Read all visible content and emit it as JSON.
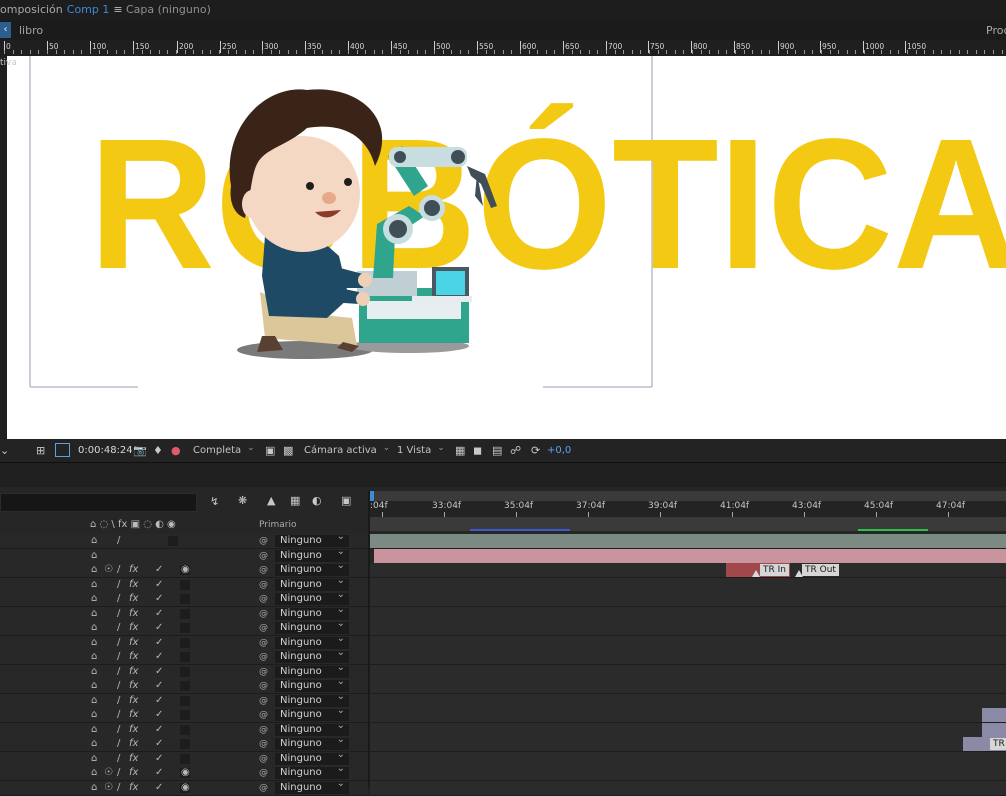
{
  "tabs": {
    "composition_prefix": "omposición",
    "composition_name": "Comp 1",
    "menu_icon": "≡",
    "layer_tab": "Capa (ninguno)"
  },
  "breadcrumb": {
    "back_icon": "chevron-left-icon",
    "item": "libro",
    "right_text": "Proc"
  },
  "ruler": {
    "labels": [
      "0",
      "50",
      "100",
      "150",
      "200",
      "250",
      "300",
      "350",
      "400",
      "450",
      "500",
      "550",
      "600",
      "650",
      "700",
      "750",
      "800",
      "850",
      "900",
      "950",
      "1000",
      "1050"
    ]
  },
  "viewer": {
    "side_text": "tiva",
    "title_text": "ROBÓTICA",
    "title_color": "#f4c914"
  },
  "viewer_toolbar": {
    "timecode": "0:00:48:24",
    "resolution": "Completa",
    "camera": "Cámara activa",
    "view": "1 Vista",
    "exposure": "+0,0"
  },
  "timeline": {
    "column_header_parent": "Primario",
    "time_labels": [
      ":04f",
      "33:04f",
      "35:04f",
      "37:04f",
      "39:04f",
      "41:04f",
      "43:04f",
      "45:04f",
      "47:04f"
    ],
    "parent_value": "Ninguno",
    "tr_in": "TR In",
    "tr_out": "TR Out",
    "tr_small": "TR"
  }
}
